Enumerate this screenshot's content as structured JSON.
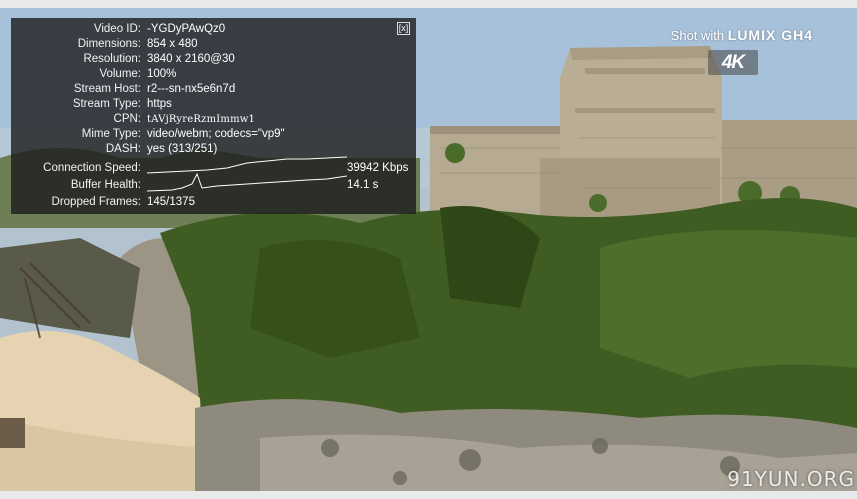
{
  "stats": {
    "close_label": "[x]",
    "rows": [
      {
        "label": "Video ID:",
        "value": "-YGDyPAwQz0"
      },
      {
        "label": "Dimensions:",
        "value": "854 x 480"
      },
      {
        "label": "Resolution:",
        "value": "3840 x 2160@30"
      },
      {
        "label": "Volume:",
        "value": "100%"
      },
      {
        "label": "Stream Host:",
        "value": "r2---sn-nx5e6n7d"
      },
      {
        "label": "Stream Type:",
        "value": "https"
      },
      {
        "label": "CPN:",
        "value": "tAVjRyreRzmImmw1"
      },
      {
        "label": "Mime Type:",
        "value": "video/webm; codecs=\"vp9\""
      },
      {
        "label": "DASH:",
        "value": "yes (313/251)"
      },
      {
        "label": "Connection Speed:",
        "value": "39942 Kbps"
      },
      {
        "label": "Buffer Health:",
        "value": "14.1 s"
      },
      {
        "label": "Dropped Frames:",
        "value": "145/1375"
      }
    ]
  },
  "overlay": {
    "brand_prefix": "Shot with ",
    "brand_name": "LUMIX GH4",
    "badge": "4K",
    "watermark": "91YUN.ORG"
  },
  "colors": {
    "sky": "#a9c3dc",
    "stone": "#b0a48e",
    "vegetation": "#3f5d22",
    "sand": "#e7d5b5",
    "panel": "#1c1c1c"
  }
}
